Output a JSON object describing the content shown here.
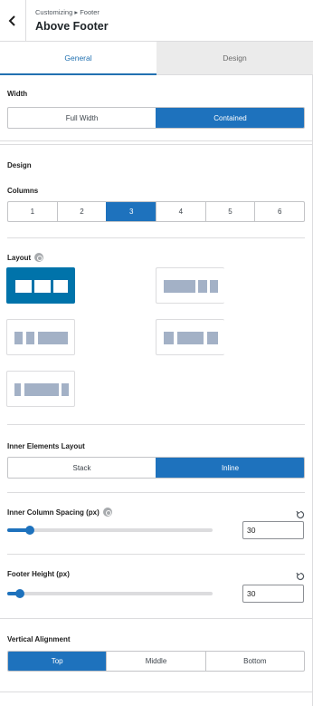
{
  "header": {
    "breadcrumb": "Customizing ▸ Footer",
    "title": "Above Footer",
    "back_icon": "chevron-left-icon"
  },
  "tabs": [
    {
      "label": "General",
      "active": true
    },
    {
      "label": "Design",
      "active": false
    }
  ],
  "width": {
    "label": "Width",
    "options": [
      "Full Width",
      "Contained"
    ],
    "selected": "Contained"
  },
  "design": {
    "heading": "Design"
  },
  "columns": {
    "label": "Columns",
    "options": [
      "1",
      "2",
      "3",
      "4",
      "5",
      "6"
    ],
    "selected": "3"
  },
  "layout": {
    "label": "Layout",
    "info_icon": "info-icon",
    "options": [
      "equal",
      "left-heavy",
      "right-heavy",
      "center-heavy",
      "center-wide"
    ],
    "selected": "equal"
  },
  "inner_layout": {
    "label": "Inner Elements Layout",
    "options": [
      "Stack",
      "Inline"
    ],
    "selected": "Inline"
  },
  "inner_spacing": {
    "label": "Inner Column Spacing (px)",
    "value": "30",
    "fraction": 0.11,
    "reset_icon": "reset-icon"
  },
  "footer_height": {
    "label": "Footer Height (px)",
    "value": "30",
    "fraction": 0.06,
    "reset_icon": "reset-icon"
  },
  "vertical_alignment": {
    "label": "Vertical Alignment",
    "options": [
      "Top",
      "Middle",
      "Bottom"
    ],
    "selected": "Top"
  },
  "colors": {
    "accent": "#1e72bd",
    "layout_selected": "#0073aa",
    "block": "#a3b1c6"
  }
}
